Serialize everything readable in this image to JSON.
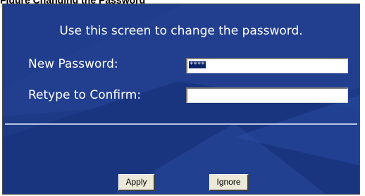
{
  "caption": "Figure Changing the Password",
  "screen": {
    "heading": "Use this screen to change the password.",
    "fields": [
      {
        "label": "New Password:",
        "value": "****"
      },
      {
        "label": "Retype to Confirm:",
        "value": ""
      }
    ],
    "buttons": {
      "apply": "Apply",
      "ignore": "Ignore"
    }
  },
  "colors": {
    "panel_background": "#1f3f8c",
    "panel_accent": "#2f5fb4",
    "text": "#ffffff",
    "divider": "#b9c4e4",
    "button_face": "#ece9d8",
    "selection": "#0a246a"
  }
}
